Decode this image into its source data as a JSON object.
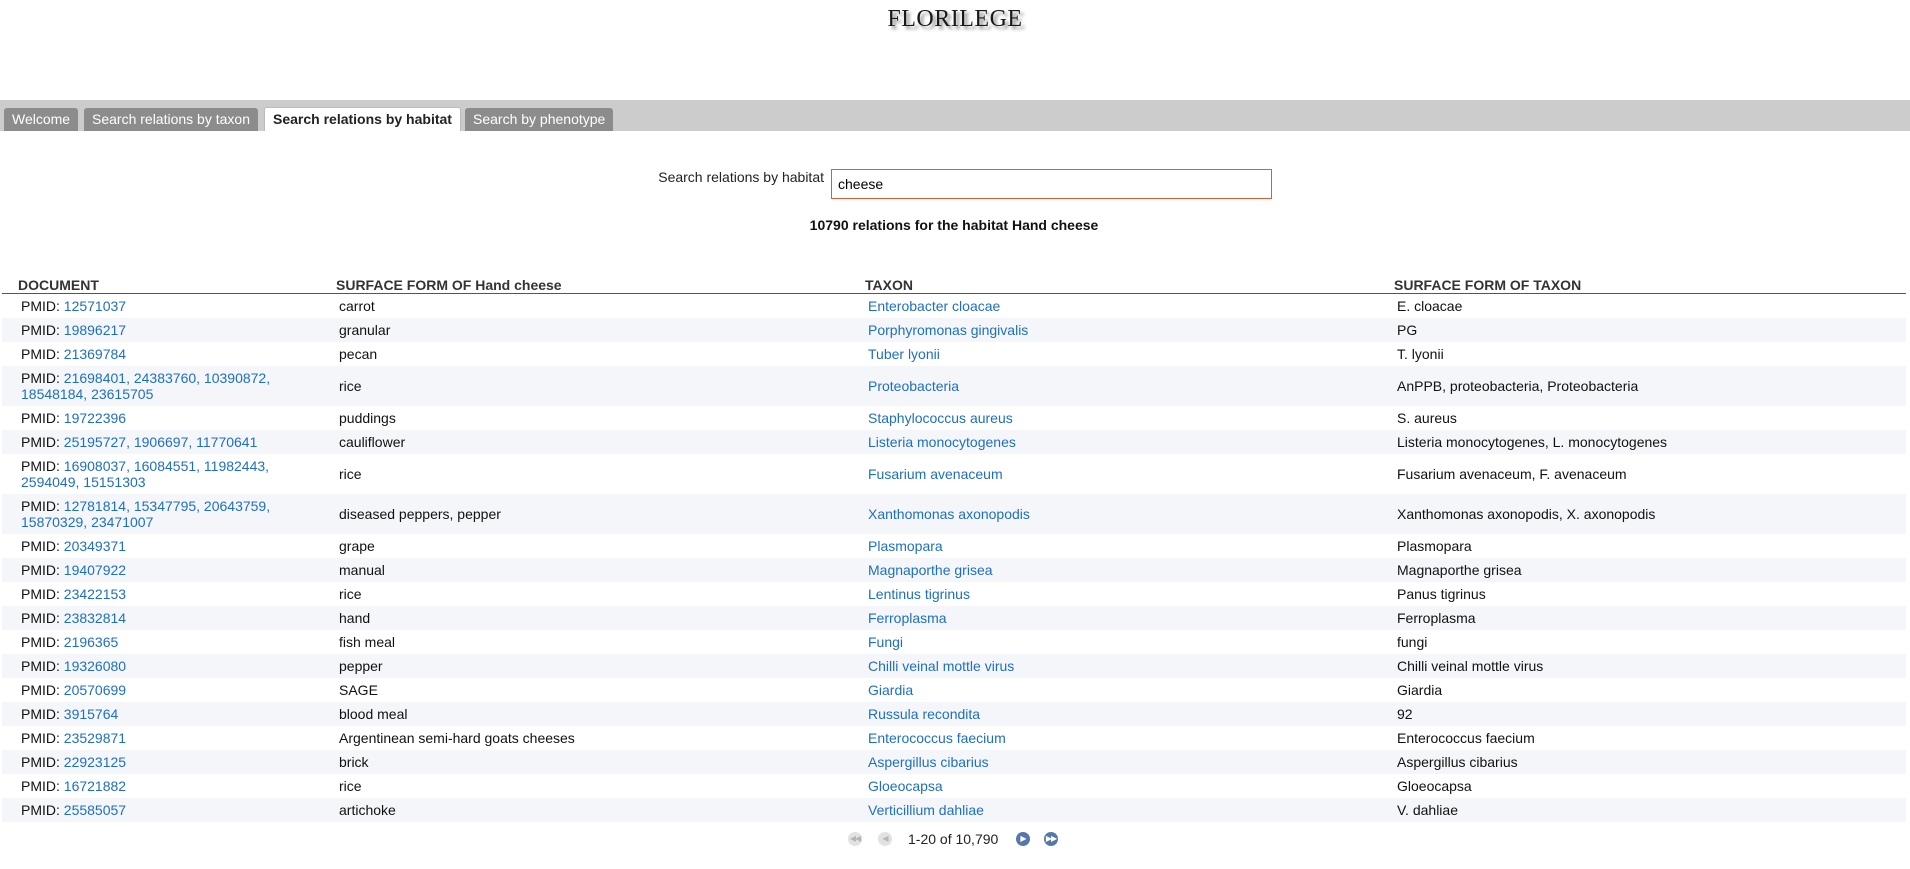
{
  "site": {
    "title": "FLORILEGE"
  },
  "tabs": [
    {
      "label": "Welcome"
    },
    {
      "label": "Search relations by taxon"
    },
    {
      "label": "Search relations by habitat"
    },
    {
      "label": "Search by phenotype"
    }
  ],
  "search": {
    "label": "Search relations by habitat",
    "value": "cheese"
  },
  "summary": "10790 relations for the habitat Hand cheese",
  "table": {
    "headers": [
      "DOCUMENT",
      "SURFACE FORM OF Hand cheese",
      "TAXON",
      "SURFACE FORM OF TAXON"
    ],
    "rows": [
      {
        "doc_prefix": "PMID: ",
        "doc_ids": "12571037",
        "surface": "carrot",
        "taxon": "Enterobacter cloacae",
        "taxon_surface": "E. cloacae"
      },
      {
        "doc_prefix": "PMID: ",
        "doc_ids": "19896217",
        "surface": "granular",
        "taxon": "Porphyromonas gingivalis",
        "taxon_surface": "PG"
      },
      {
        "doc_prefix": "PMID: ",
        "doc_ids": "21369784",
        "surface": "pecan",
        "taxon": "Tuber lyonii",
        "taxon_surface": "T. lyonii"
      },
      {
        "doc_prefix": "PMID: ",
        "doc_ids": "21698401, 24383760, 10390872, 18548184, 23615705",
        "surface": "rice",
        "taxon": "Proteobacteria",
        "taxon_surface": "AnPPB, proteobacteria, Proteobacteria"
      },
      {
        "doc_prefix": "PMID: ",
        "doc_ids": "19722396",
        "surface": "puddings",
        "taxon": "Staphylococcus aureus",
        "taxon_surface": "S. aureus"
      },
      {
        "doc_prefix": "PMID: ",
        "doc_ids": "25195727, 1906697, 11770641",
        "surface": "cauliflower",
        "taxon": "Listeria monocytogenes",
        "taxon_surface": "Listeria monocytogenes, L. monocytogenes"
      },
      {
        "doc_prefix": "PMID: ",
        "doc_ids": "16908037, 16084551, 11982443, 2594049, 15151303",
        "surface": "rice",
        "taxon": "Fusarium avenaceum",
        "taxon_surface": "Fusarium avenaceum, F. avenaceum"
      },
      {
        "doc_prefix": "PMID: ",
        "doc_ids": "12781814, 15347795, 20643759, 15870329, 23471007",
        "surface": "diseased peppers, pepper",
        "taxon": "Xanthomonas axonopodis",
        "taxon_surface": "Xanthomonas axonopodis, X. axonopodis"
      },
      {
        "doc_prefix": "PMID: ",
        "doc_ids": "20349371",
        "surface": "grape",
        "taxon": "Plasmopara",
        "taxon_surface": "Plasmopara"
      },
      {
        "doc_prefix": "PMID: ",
        "doc_ids": "19407922",
        "surface": "manual",
        "taxon": "Magnaporthe grisea",
        "taxon_surface": "Magnaporthe grisea"
      },
      {
        "doc_prefix": "PMID: ",
        "doc_ids": "23422153",
        "surface": "rice",
        "taxon": "Lentinus tigrinus",
        "taxon_surface": "Panus tigrinus"
      },
      {
        "doc_prefix": "PMID: ",
        "doc_ids": "23832814",
        "surface": "hand",
        "taxon": "Ferroplasma",
        "taxon_surface": "Ferroplasma"
      },
      {
        "doc_prefix": "PMID: ",
        "doc_ids": "2196365",
        "surface": "fish meal",
        "taxon": "Fungi",
        "taxon_surface": "fungi"
      },
      {
        "doc_prefix": "PMID: ",
        "doc_ids": "19326080",
        "surface": "pepper",
        "taxon": "Chilli veinal mottle virus",
        "taxon_surface": "Chilli veinal mottle virus"
      },
      {
        "doc_prefix": "PMID: ",
        "doc_ids": "20570699",
        "surface": "SAGE",
        "taxon": "Giardia",
        "taxon_surface": "Giardia"
      },
      {
        "doc_prefix": "PMID: ",
        "doc_ids": "3915764",
        "surface": "blood meal",
        "taxon": "Russula recondita",
        "taxon_surface": "92"
      },
      {
        "doc_prefix": "PMID: ",
        "doc_ids": "23529871",
        "surface": "Argentinean semi-hard goats cheeses",
        "taxon": "Enterococcus faecium",
        "taxon_surface": "Enterococcus faecium"
      },
      {
        "doc_prefix": "PMID: ",
        "doc_ids": "22923125",
        "surface": "brick",
        "taxon": "Aspergillus cibarius",
        "taxon_surface": "Aspergillus cibarius"
      },
      {
        "doc_prefix": "PMID: ",
        "doc_ids": "16721882",
        "surface": "rice",
        "taxon": "Gloeocapsa",
        "taxon_surface": "Gloeocapsa"
      },
      {
        "doc_prefix": "PMID: ",
        "doc_ids": "25585057",
        "surface": "artichoke",
        "taxon": "Verticillium dahliae",
        "taxon_surface": "V. dahliae"
      }
    ]
  },
  "pager": {
    "status": "1-20 of 10,790",
    "first_icon": "first-page-icon",
    "prev_icon": "previous-page-icon",
    "next_icon": "next-page-icon",
    "last_icon": "last-page-icon"
  },
  "colors": {
    "link": "#1f6fbf",
    "tab_active": "#ffffff",
    "tab_inactive": "#8c8c8c",
    "tab_bar": "#cccccc",
    "input_border": "#e05a3a"
  }
}
